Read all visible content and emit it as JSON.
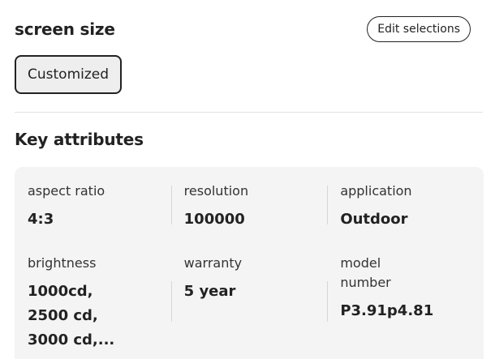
{
  "selection": {
    "title": "screen size",
    "edit_label": "Edit selections",
    "chip_label": "Customized"
  },
  "key_attributes": {
    "title": "Key attributes",
    "items": [
      {
        "label": "aspect ratio",
        "value": "4:3"
      },
      {
        "label": "resolution",
        "value": "100000"
      },
      {
        "label": "application",
        "value": "Outdoor"
      },
      {
        "label": "brightness",
        "value": "1000cd,\n2500 cd,\n3000 cd,..."
      },
      {
        "label": "warranty",
        "value": "5 year"
      },
      {
        "label": "model\nnumber",
        "value": "P3.91p4.81"
      }
    ]
  }
}
